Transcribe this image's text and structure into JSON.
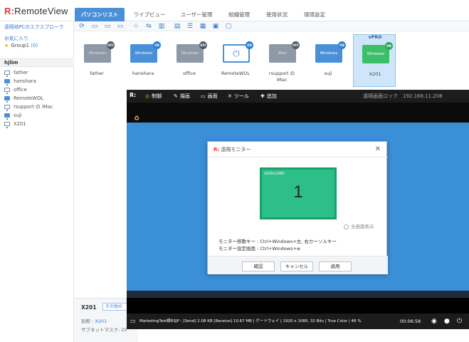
{
  "app": {
    "logo_mark": "R",
    "title": "RemoteView"
  },
  "tabs": [
    {
      "label": "パソコンリスト",
      "active": true
    },
    {
      "label": "ライブビュー"
    },
    {
      "label": "ユーザー管理"
    },
    {
      "label": "組織管理"
    },
    {
      "label": "使用状況"
    },
    {
      "label": "環境設定"
    }
  ],
  "sidebar": {
    "explorer_link": "遠隔地PCのエクスプローラ",
    "favorites_label": "お気に入り",
    "group_name": "Group1",
    "group_count": "(0)",
    "section_title": "hjlim",
    "computers": [
      "father",
      "hanshara",
      "office",
      "RemoteWOL",
      "rsupport の iMac",
      "suji",
      "X201"
    ]
  },
  "devices": [
    {
      "name": "father",
      "screen": "Windows",
      "status": "OFF"
    },
    {
      "name": "hanshara",
      "screen": "Windows",
      "status": "ON"
    },
    {
      "name": "office",
      "screen": "Windows",
      "status": "OFF"
    },
    {
      "name": "RemoteWOL",
      "screen": "",
      "status": "ON"
    },
    {
      "name": "rsupport の",
      "name2": "iMac",
      "screen": "iMac",
      "status": "OFF"
    },
    {
      "name": "suji",
      "screen": "Windows",
      "status": "ON"
    },
    {
      "name": "X201",
      "screen": "Windows",
      "status": "ON",
      "header": "vPRO"
    }
  ],
  "detail": {
    "name": "X201",
    "other_button": "その他の",
    "alias_label": "別称 :",
    "alias_value": "X201",
    "subnet_label": "サブネットマスク: 25"
  },
  "remote": {
    "menu": [
      "制御",
      "描画",
      "画面",
      "ツール",
      "追加"
    ],
    "lock_text": "遠隔画面ロック　192.168.11.208",
    "status_text": "MarketingTest様RSJP : [Send] 2.08 KB  [Receive] 10.67 MB | ゲートウェイ | 1920 x 1080, 32 Bits | True Color | 46 %",
    "timer": "00:06:58"
  },
  "dialog": {
    "logo_mark": "R:",
    "title": "遠隔モニター",
    "monitor_resolution": "1920x1080",
    "monitor_number": "1",
    "fullscreen_label": "全画面表示",
    "line1": "モニター移動キー : Ctrl+Windows+左, 右カーソルキー",
    "line2": "モニター設定画面 : Ctrl+Windows+w",
    "ok": "確認",
    "cancel": "キャンセル",
    "apply": "適用"
  },
  "colors": {
    "accent": "#4a90d9",
    "brand": "#e03a3a",
    "remote_desktop": "#3a8fd6",
    "monitor_green": "#2cbf8a"
  }
}
